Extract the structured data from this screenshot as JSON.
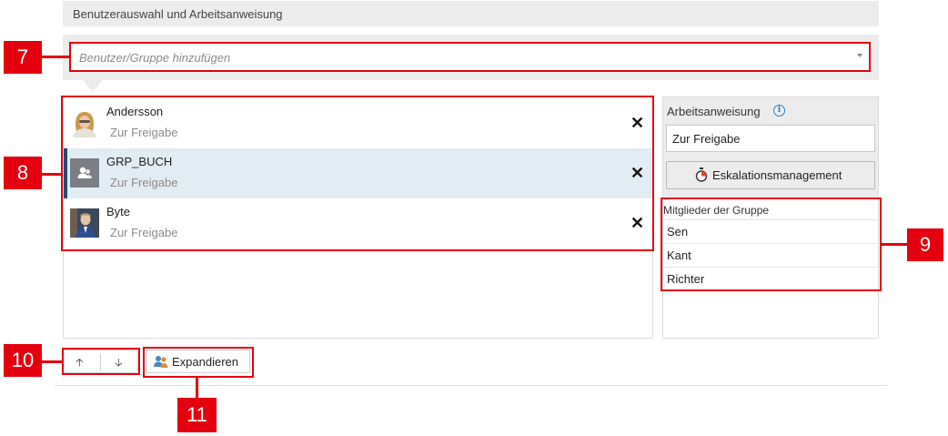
{
  "section": {
    "title": "Benutzerauswahl und Arbeitsanweisung"
  },
  "combo": {
    "placeholder": "Benutzer/Gruppe hinzufügen"
  },
  "list": {
    "rows": [
      {
        "name": "Andersson",
        "instruction": "Zur Freigabe",
        "type": "user",
        "selected": false
      },
      {
        "name": "GRP_BUCH",
        "instruction": "Zur Freigabe",
        "type": "group",
        "selected": true
      },
      {
        "name": "Byte",
        "instruction": "Zur Freigabe",
        "type": "user",
        "selected": false
      }
    ],
    "remove_glyph": "✕"
  },
  "instruction_panel": {
    "label": "Arbeitsanweisung",
    "info_glyph": "i",
    "value": "Zur Freigabe",
    "escalation_label": "Eskalationsmanagement"
  },
  "group_members": {
    "title": "Mitglieder der Gruppe",
    "members": [
      "Sen",
      "Kant",
      "Richter"
    ]
  },
  "toolbar": {
    "up_glyph": "🡡",
    "down_glyph": "🡣",
    "expand_label": "Expandieren"
  },
  "callouts": [
    "7",
    "8",
    "9",
    "10",
    "11"
  ],
  "colors": {
    "callout": "#e4000f",
    "selection": "#1b4e7d",
    "info": "#2b7fd0"
  },
  "icons": {
    "info": "info-icon",
    "remove": "close-icon",
    "escalation": "stopwatch-icon",
    "expand": "group-expand-icon",
    "up": "arrow-up-icon",
    "down": "arrow-down-icon"
  }
}
